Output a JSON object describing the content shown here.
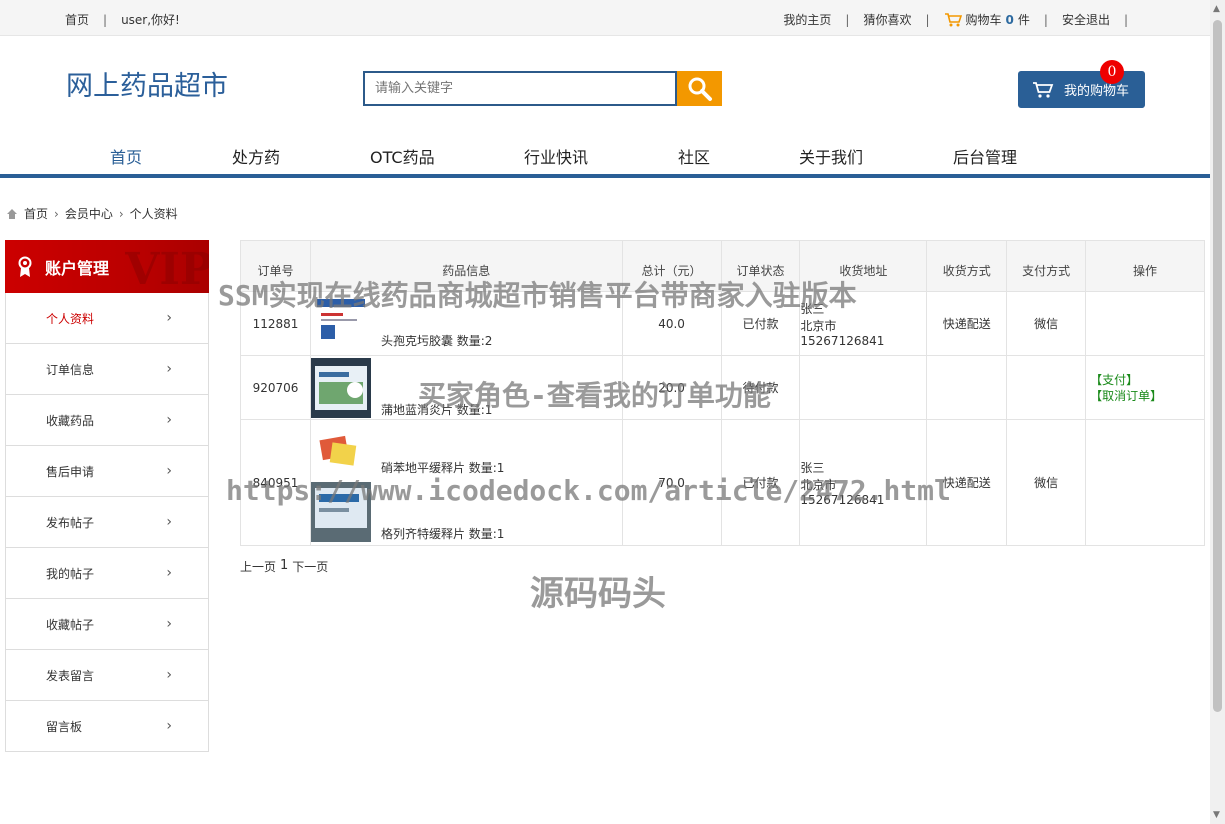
{
  "topbar": {
    "home": "首页",
    "greeting": "user,你好!",
    "my_home": "我的主页",
    "guess": "猜你喜欢",
    "cart_prefix": "购物车",
    "cart_count": "0",
    "cart_suffix": "件",
    "logout": "安全退出"
  },
  "header": {
    "logo": "网上药品超市",
    "search_placeholder": "请输入关键字",
    "cart_button": "我的购物车",
    "cart_badge": "0"
  },
  "nav": [
    "首页",
    "处方药",
    "OTC药品",
    "行业快讯",
    "社区",
    "关于我们",
    "后台管理"
  ],
  "breadcrumb": [
    "首页",
    "会员中心",
    "个人资料"
  ],
  "sidebar": {
    "title": "账户管理",
    "items": [
      "个人资料",
      "订单信息",
      "收藏药品",
      "售后申请",
      "发布帖子",
      "我的帖子",
      "收藏帖子",
      "发表留言",
      "留言板"
    ]
  },
  "table": {
    "headers": [
      "订单号",
      "药品信息",
      "总计（元）",
      "订单状态",
      "收货地址",
      "收货方式",
      "支付方式",
      "操作"
    ],
    "rows": [
      {
        "id": "112881",
        "drugs": [
          {
            "name": "头孢克圬胶囊 数量:2"
          }
        ],
        "total": "40.0",
        "status": "已付款",
        "addr_name": "张三",
        "addr_city": "北京市",
        "addr_phone": "15267126841",
        "ship": "快递配送",
        "pay": "微信"
      },
      {
        "id": "920706",
        "drugs": [
          {
            "name": "蒲地蓝消炎片 数量:1"
          }
        ],
        "total": "20.0",
        "status": "待付款",
        "op1": "【支付】",
        "op2": "【取消订单】"
      },
      {
        "id": "840951",
        "drugs": [
          {
            "name": "硝苯地平缓释片 数量:1"
          },
          {
            "name": "格列齐特缓释片 数量:1"
          }
        ],
        "total": "70.0",
        "status": "已付款",
        "addr_name": "张三",
        "addr_city": "北京市",
        "addr_phone": "15267126841",
        "ship": "快递配送",
        "pay": "微信"
      }
    ]
  },
  "pager": {
    "prev": "上一页",
    "current": "1",
    "next": "下一页"
  },
  "watermarks": {
    "line1": "SSM实现在线药品商城超市销售平台带商家入驻版本",
    "line2": "买家角色-查看我的订单功能",
    "line3": "https://www.icodedock.com/article/2472.html",
    "line4": "源码码头"
  },
  "colors": {
    "brand": "#2a5f96",
    "accent": "#f39800",
    "sidebar_head": "#c00000",
    "op_link": "#1a8a1a"
  }
}
